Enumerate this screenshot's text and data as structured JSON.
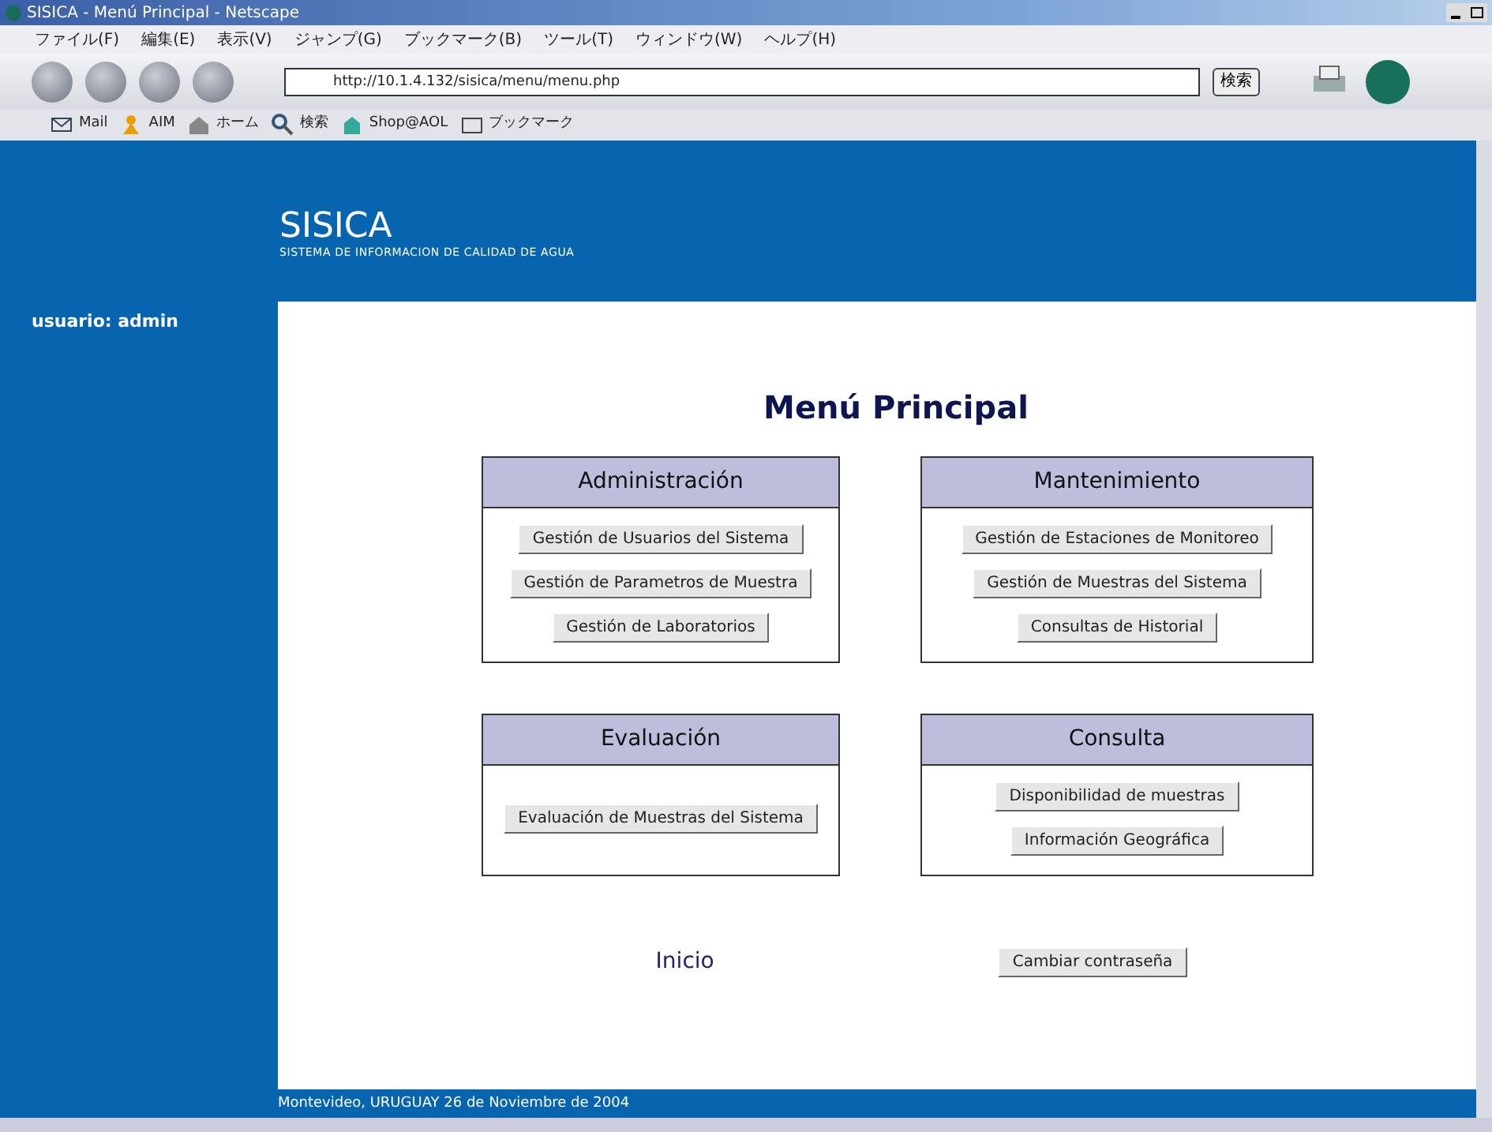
{
  "window": {
    "title": "SISICA - Menú Principal - Netscape"
  },
  "menu": [
    "ファイル(F)",
    "編集(E)",
    "表示(V)",
    "ジャンプ(G)",
    "ブックマーク(B)",
    "ツール(T)",
    "ウィンドウ(W)",
    "ヘルプ(H)"
  ],
  "address": {
    "value": "http://10.1.4.132/sisica/menu/menu.php"
  },
  "search_button": "検索",
  "bookmarks": [
    {
      "kind": "mail",
      "label": "Mail"
    },
    {
      "kind": "aim",
      "label": "AIM"
    },
    {
      "kind": "home",
      "label": "ホーム"
    },
    {
      "kind": "search",
      "label": "検索"
    },
    {
      "kind": "shop",
      "label": "Shop@AOL"
    },
    {
      "kind": "folder",
      "label": "ブックマーク"
    }
  ],
  "header": {
    "title": "SISICA",
    "subtitle": "SISTEMA DE INFORMACION DE CALIDAD DE AGUA"
  },
  "sidebar": {
    "user": "usuario: admin"
  },
  "page_title": "Menú Principal",
  "panels": [
    {
      "title": "Administración",
      "buttons": [
        "Gestión de Usuarios del Sistema",
        "Gestión de Parametros de Muestra",
        "Gestión de Laboratorios"
      ]
    },
    {
      "title": "Mantenimiento",
      "buttons": [
        "Gestión de Estaciones de Monitoreo",
        "Gestión de Muestras del Sistema",
        "Consultas de Historial"
      ]
    },
    {
      "title": "Evaluación",
      "buttons": [
        "Evaluación de Muestras del Sistema"
      ]
    },
    {
      "title": "Consulta",
      "buttons": [
        "Disponibilidad de muestras",
        "Información Geográfica"
      ]
    }
  ],
  "home_link": "Inicio",
  "password_button": "Cambiar contraseña",
  "footer": "Montevideo, URUGUAY 26 de Noviembre de 2004"
}
